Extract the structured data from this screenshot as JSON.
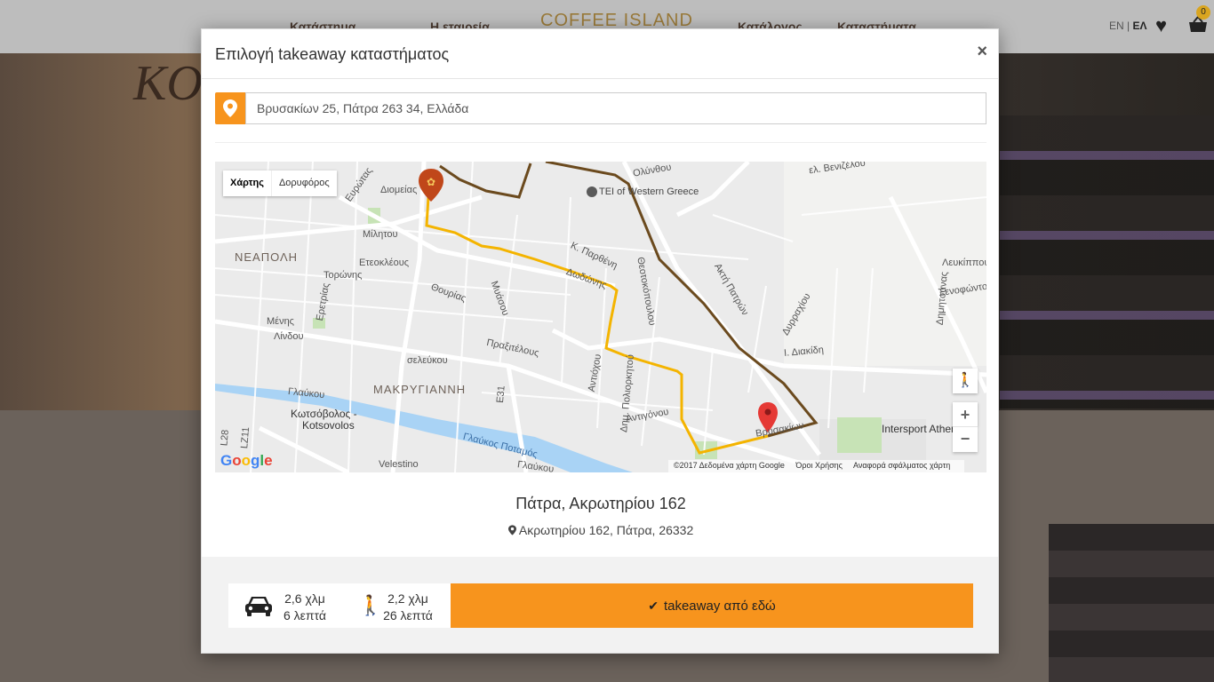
{
  "background": {
    "nav_left_1": "Κατάστημα",
    "nav_left_2": "Η εταιρεία",
    "logo": "COFFEE ISLAND",
    "nav_right_1": "Κατάλογος",
    "nav_right_2": "Καταστήματα",
    "lang_en": "EN",
    "lang_el": "ΕΛ",
    "cart_count": "0",
    "sign_text": "KO"
  },
  "modal": {
    "title": "Επιλογή takeaway καταστήματος",
    "close_glyph": "×",
    "address_value": "Βρυσακίων 25, Πάτρα 263 34, Ελλάδα",
    "map": {
      "type_map": "Χάρτης",
      "type_satellite": "Δορυφόρος",
      "zoom_in": "+",
      "zoom_out": "−",
      "attribution": "©2017 Δεδομένα χάρτη Google",
      "terms": "Όροι Χρήσης",
      "report": "Αναφορά σφάλματος χάρτη",
      "google": "Google",
      "labels": {
        "neapoli": "ΝΕΑΠΟΛΗ",
        "makrygianni": "ΜΑΚΡΥΓΙΑΝΝΗ",
        "tei": "TEI of Western Greece",
        "kotsovolos": "Κωτσόβολος -",
        "kotsovolos2": "Kotsovolos",
        "intersport": "Intersport Athens",
        "river": "Γλαύκος Ποταμός",
        "glafkou": "Γλαύκου",
        "miltou": "Μίλητου",
        "eteokleous": "Ετεοκλέους",
        "toronis": "Τορώνης",
        "thourias": "Θουρίας",
        "myaseou": "Μυάσου",
        "praxitelous": "Πραξιτέλους",
        "seleukou": "σελεύκου",
        "antiochou": "Αντιόχου",
        "poliorkitou": "Δημ. Πολιορκητού",
        "antigonou": "Αντιγόνου",
        "theotokopoulou": "Θεοτοκόπουλου",
        "diakidi": "Ι. Διακίδη",
        "olynthou": "Ολύνθου",
        "venizelou": "ελ. Βενιζέλου",
        "parthenis": "Κ. Παρθένη",
        "dodonis": "Δωδώνης",
        "diomeias": "Διομείας",
        "evrotas": "Ευρώτας",
        "menis": "Μένης",
        "lindou": "Λίνδου",
        "eretrias": "Ερετρίας",
        "ak_patron": "Ακτή Πατρών",
        "dyrrachiou": "Δυρραχίου",
        "dimitsanas": "Δημητσάνας",
        "leukippou": "Λευκίππου",
        "xenofontos": "Ξενοφώντος",
        "vrysakion": "Βρυσακίων",
        "e31": "E31",
        "l28": "L28",
        "lz11": "LZ11",
        "velestinou": "Velestino",
        "glafkou2": "Γλαύκου"
      }
    },
    "store_name": "Πάτρα, Ακρωτηρίου 162",
    "store_address": "Ακρωτηρίου 162, Πάτρα, 26332",
    "car_distance": "2,6 χλμ",
    "car_time": "6 λεπτά",
    "walk_distance": "2,2 χλμ",
    "walk_time": "26 λεπτά",
    "cta_label": "takeaway από εδώ",
    "colors": {
      "accent": "#f7941d",
      "route_walk": "#f4b400",
      "route_drive": "#6b4a1e",
      "river": "#a9d3f5"
    }
  }
}
